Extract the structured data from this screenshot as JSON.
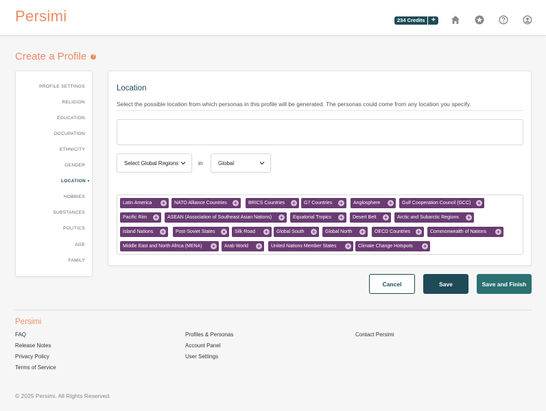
{
  "header": {
    "logo": "Persimi",
    "credits_label": "234 Credits",
    "credits_plus": "+",
    "icons": [
      "home-icon",
      "star-icon",
      "help-icon",
      "user-icon"
    ]
  },
  "page": {
    "title": "Create a Profile",
    "help": "?"
  },
  "sidebar": {
    "items": [
      {
        "label": "PROFILE SETTINGS"
      },
      {
        "label": "RELIGION"
      },
      {
        "label": "EDUCATION"
      },
      {
        "label": "OCCUPATION"
      },
      {
        "label": "ETHNICITY"
      },
      {
        "label": "GENDER"
      },
      {
        "label": "LOCATION"
      },
      {
        "label": "HOBBIES"
      },
      {
        "label": "SUBSTANCES"
      },
      {
        "label": "POLITICS"
      },
      {
        "label": "AGE"
      },
      {
        "label": "FAMILY"
      }
    ],
    "active": "LOCATION"
  },
  "location": {
    "title": "Location",
    "description": "Select the possible location from which personas in this profile will be generated. The personas could come from any location you specify.",
    "input_value": "",
    "region_select": "Select Global Regions",
    "in_label": "in",
    "scope_select": "Global",
    "tags": [
      "Latin America",
      "NATO Alliance Countries",
      "BRICS Countries",
      "G7 Countries",
      "Anglosphere",
      "Gulf Cooperation Council (GCC)",
      "Pacific Rim",
      "ASEAN (Association of Southeast Asian Nations)",
      "Equatorial Tropics",
      "Desert Belt",
      "Arctic and Subarctic Regions",
      "Island Nations",
      "Post-Soviet States",
      "Silk Road",
      "Global South",
      "Global North",
      "OECD Countries",
      "Commonwealth of Nations",
      "Middle East and North Africa (MENA)",
      "Arab World",
      "United Nations Member States",
      "Climate Change Hotspots"
    ],
    "tag_plus": "+"
  },
  "actions": {
    "cancel": "Cancel",
    "save": "Save",
    "save_finish": "Save and Finish"
  },
  "footer": {
    "logo": "Persimi",
    "col1": [
      "FAQ",
      "Release Notes",
      "Privacy Policy",
      "Terms of Service"
    ],
    "col2": [
      "Profiles & Personas",
      "Account Panel",
      "User Settings"
    ],
    "col3": [
      "Contact Persimi"
    ],
    "copyright": "© 2025 Persimi. All Rights Reserved."
  },
  "colors": {
    "brand": "#ef8a63",
    "primary": "#1f4b59",
    "tag": "#6b3b73",
    "finish": "#2a7170"
  }
}
